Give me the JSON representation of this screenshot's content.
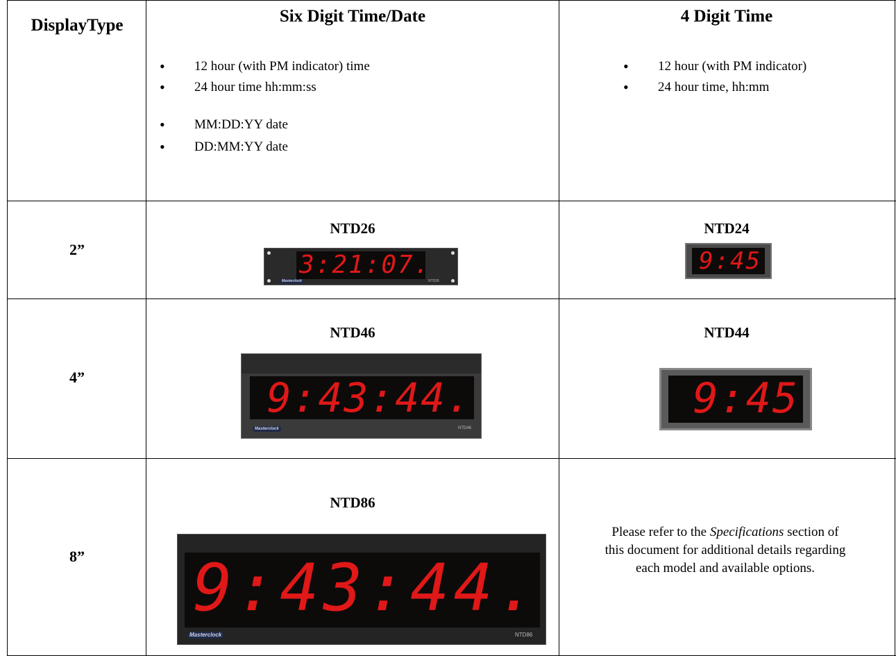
{
  "table": {
    "header": {
      "col1": "DisplayType",
      "col2": "Six Digit Time/Date",
      "col3": "4 Digit Time"
    },
    "six_digit_features": [
      "12 hour (with PM indicator) time",
      "24 hour time hh:mm:ss",
      "MM:DD:YY date",
      "DD:MM:YY date"
    ],
    "four_digit_features": [
      "12 hour (with PM indicator)",
      "24 hour time, hh:mm"
    ],
    "rows": [
      {
        "size": "2”",
        "six_model": "NTD26",
        "six_display": "3:21:07.",
        "four_model": "NTD24",
        "four_display": "9:45"
      },
      {
        "size": "4”",
        "six_model": "NTD46",
        "six_display": "9:43:44.",
        "four_model": "NTD44",
        "four_display": "9:45"
      },
      {
        "size": "8”",
        "six_model": "NTD86",
        "six_display": "9:43:44.",
        "note_before": "Please refer to the ",
        "note_italic": "Specifications",
        "note_after": " section of this document for additional details regarding each model and available options."
      }
    ],
    "brand_label": "Masterclock",
    "device_tags": [
      "NTD26",
      "NTD46",
      "NTD86"
    ]
  }
}
